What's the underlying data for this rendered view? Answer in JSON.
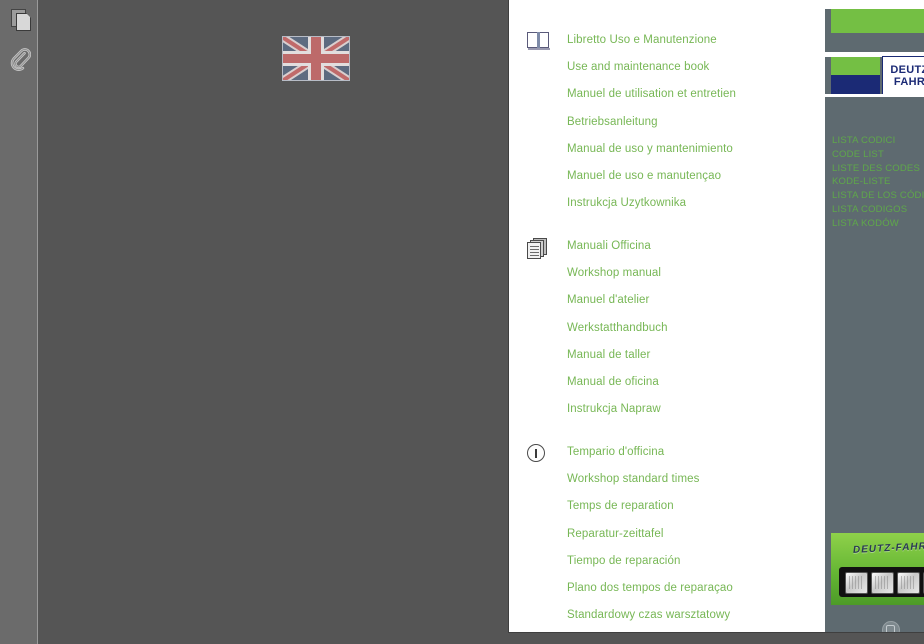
{
  "viewer": {
    "sidebar": {
      "items": [
        {
          "name": "page-thumbnails",
          "icon": "pages-icon",
          "label": "Page Thumbnails"
        },
        {
          "name": "attachments",
          "icon": "paperclip-icon",
          "label": "Attachments"
        }
      ]
    }
  },
  "page": {
    "groups": [
      {
        "id": "manual",
        "icon": "open-book-icon",
        "lines": [
          "Libretto Uso e Manutenzione",
          "Use and maintenance book",
          "Manuel de utilisation et entretien",
          "Betriebsanleitung",
          "Manual de uso y mantenimiento",
          " Manuel de uso e manutençao",
          "Instrukcja Uzytkownika"
        ]
      },
      {
        "id": "workshop",
        "icon": "documents-stack-icon",
        "lines": [
          "Manuali Officina",
          "Workshop manual",
          "Manuel d'atelier",
          "Werkstatthandbuch",
          "Manual de taller",
          "Manual de oficina",
          "Instrukcja Napraw"
        ]
      },
      {
        "id": "times",
        "icon": "clock-icon",
        "lines": [
          "Tempario d'officina",
          "Workshop standard times",
          "Temps de reparation",
          "Reparatur-zeittafel",
          "Tiempo de reparación",
          "Plano dos tempos de reparaçao",
          "Standardowy czas warsztatowy"
        ]
      }
    ],
    "flag": {
      "name": "uk-flag",
      "label": "United Kingdom"
    },
    "brand": {
      "logo_line1": "DEUTZ",
      "logo_line2": "FAHR",
      "code_list": [
        "LISTA CODICI",
        "CODE LIST",
        "LISTE DES CODES",
        "KODE-LISTE",
        "LISTA DE LOS CÓDIGOS",
        " LISTA  CODIGOS",
        "LISTA KODÓW"
      ],
      "tractor_hood_text": "DEUTZ-FAHR"
    }
  },
  "colors": {
    "brand_green": "#74bf44",
    "text_green": "#77b755",
    "code_green": "#5fa84a",
    "brand_blue": "#1b2a75",
    "panel_gray": "#5e6a70",
    "viewer_bg": "#555555",
    "sidebar_bg": "#6b6b6b"
  }
}
